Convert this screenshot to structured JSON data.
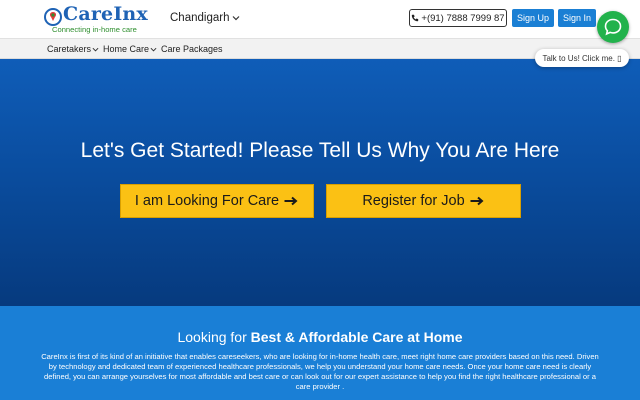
{
  "brand": {
    "name": "CareInx",
    "tagline": "Connecting in-home care"
  },
  "header": {
    "city": "Chandigarh",
    "phone_label": "+(91) 7888 7999 87",
    "signup_label": "Sign Up",
    "signin_label": "Sign In",
    "chat_prompt": "Talk to Us! Click me. ▯"
  },
  "nav": {
    "items": [
      {
        "label": "Caretakers"
      },
      {
        "label": "Home Care"
      },
      {
        "label": "Care Packages"
      }
    ]
  },
  "hero": {
    "title": "Let's Get Started! Please Tell Us Why You Are Here",
    "cta_care": "I am Looking For Care",
    "cta_job": "Register for Job"
  },
  "info": {
    "heading_lead": "Looking for ",
    "heading_bold": "Best & Affordable Care at Home",
    "body": "CareInx is first of its kind of an initiative that enables careseekers, who are looking for in-home health care, meet right home care providers based on this need. Driven by technology and dedicated team of experienced healthcare professionals, we help you understand your home care needs. Once your home care need is clearly defined, you can arrange yourselves for most affordable and best care or can look out for our expert assistance to help you find the right healthcare professional or a care provider ."
  },
  "colors": {
    "brand_blue": "#1f63b5",
    "brand_green": "#2f8f2f",
    "button_blue": "#1a7fd4",
    "cta_yellow": "#fbc114",
    "chat_green": "#22b24c",
    "hero_blue": "#0a4d9f",
    "info_blue": "#1a7fd6"
  },
  "icons": {
    "logo": "careinx-logo-mark",
    "city_dropdown": "chevron-down-icon",
    "phone": "phone-icon",
    "chat": "chat-bubble-icon",
    "cta_arrow": "arrow-right-icon"
  }
}
